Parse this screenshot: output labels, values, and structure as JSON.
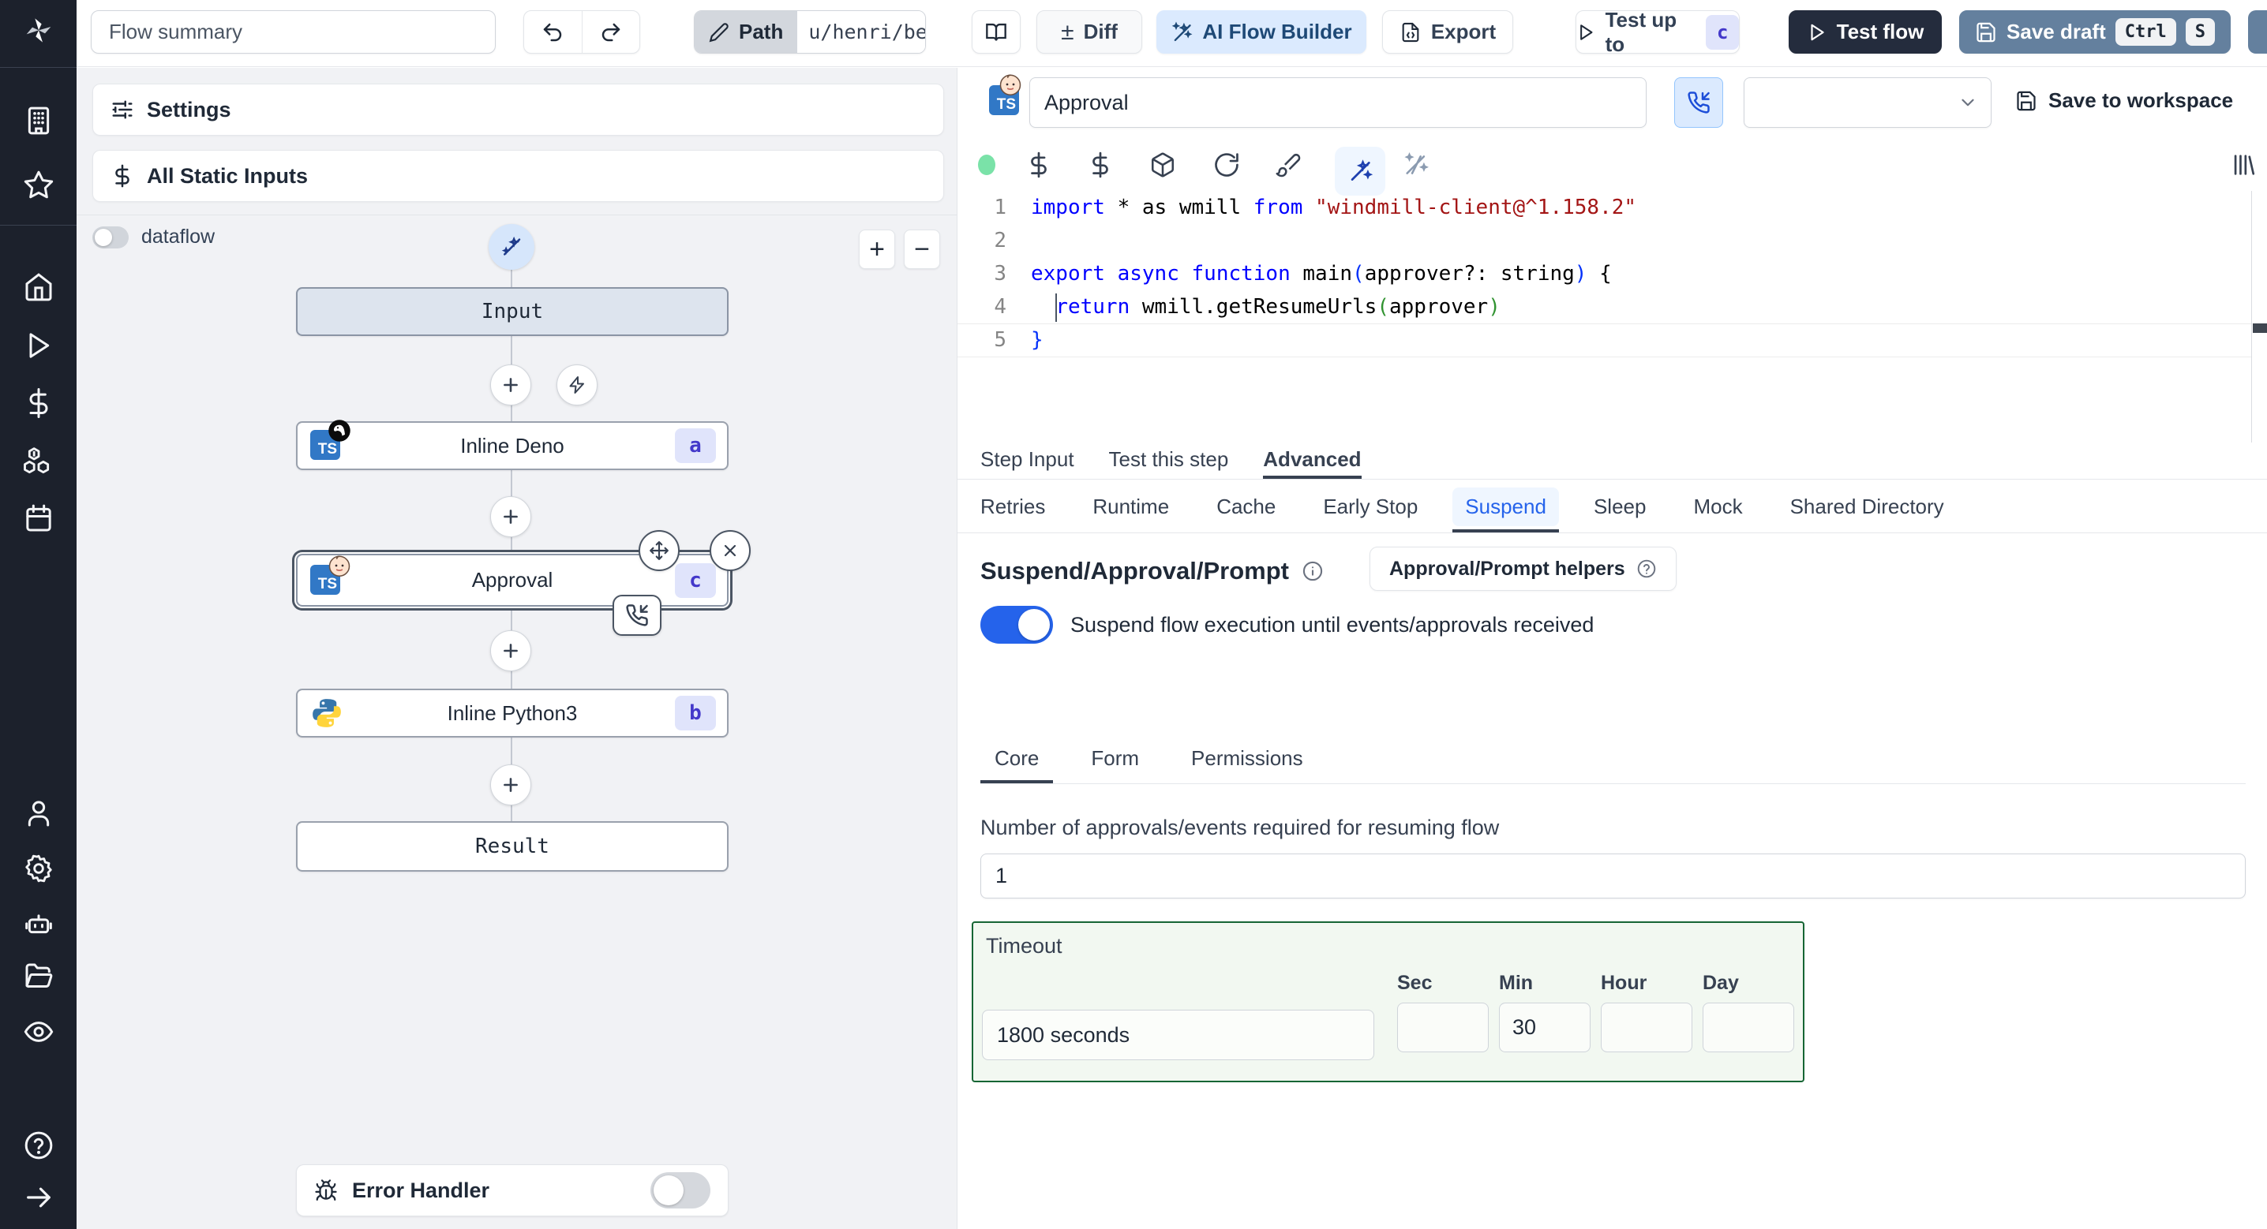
{
  "topbar": {
    "flow_summary_value": "Flow summary",
    "path_label": "Path",
    "path_value": "u/henri/bes",
    "diff_label": "Diff",
    "ai_flow_builder_label": "AI Flow Builder",
    "export_label": "Export",
    "test_up_to_label": "Test up to",
    "test_up_to_badge": "c",
    "test_flow_label": "Test flow",
    "save_draft_label": "Save draft",
    "save_draft_kbd_1": "Ctrl",
    "save_draft_kbd_2": "S"
  },
  "left_panel": {
    "settings_label": "Settings",
    "all_static_inputs_label": "All Static Inputs",
    "dataflow_label": "dataflow",
    "zoom_in_label": "+",
    "zoom_out_label": "−",
    "graph": {
      "input_label": "Input",
      "steps": [
        {
          "id": "a",
          "label": "Inline Deno"
        },
        {
          "id": "c",
          "label": "Approval"
        },
        {
          "id": "b",
          "label": "Inline Python3"
        }
      ],
      "result_label": "Result",
      "error_handler_label": "Error Handler"
    }
  },
  "step_editor": {
    "name_value": "Approval",
    "save_to_workspace_label": "Save to workspace",
    "code": {
      "lines": [
        {
          "num": "1",
          "tokens": [
            [
              "kw",
              "import"
            ],
            [
              "pl",
              " * as wmill "
            ],
            [
              "kw",
              "from"
            ],
            [
              "pl",
              " "
            ],
            [
              "str",
              "\"windmill-client@^1.158.2\""
            ]
          ]
        },
        {
          "num": "2",
          "tokens": []
        },
        {
          "num": "3",
          "tokens": [
            [
              "kw",
              "export"
            ],
            [
              "pl",
              " "
            ],
            [
              "kw",
              "async"
            ],
            [
              "pl",
              " "
            ],
            [
              "kw",
              "function"
            ],
            [
              "pl",
              " main"
            ],
            [
              "p1",
              "("
            ],
            [
              "pl",
              "approver?: string"
            ],
            [
              "p1",
              ")"
            ],
            [
              "pl",
              " {"
            ]
          ]
        },
        {
          "num": "4",
          "tokens": [
            [
              "pl",
              "  "
            ],
            [
              "kw",
              "return"
            ],
            [
              "pl",
              " wmill.getResumeUrls"
            ],
            [
              "p2",
              "("
            ],
            [
              "pl",
              "approver"
            ],
            [
              "p2",
              ")"
            ]
          ]
        },
        {
          "num": "5",
          "tokens": [
            [
              "p1",
              "}"
            ]
          ]
        }
      ]
    },
    "tabs": {
      "items": [
        "Step Input",
        "Test this step",
        "Advanced"
      ],
      "active": 2
    },
    "advanced_tabs": {
      "items": [
        "Retries",
        "Runtime",
        "Cache",
        "Early Stop",
        "Suspend",
        "Sleep",
        "Mock",
        "Shared Directory"
      ],
      "active": 4
    },
    "suspend": {
      "title": "Suspend/Approval/Prompt",
      "helpers_label": "Approval/Prompt helpers",
      "toggle_label": "Suspend flow execution until events/approvals received",
      "tabs": {
        "items": [
          "Core",
          "Form",
          "Permissions"
        ],
        "active": 0
      },
      "approvals_label": "Number of approvals/events required for resuming flow",
      "approvals_value": "1",
      "timeout": {
        "label": "Timeout",
        "value": "1800 seconds",
        "units": [
          {
            "label": "Sec",
            "value": ""
          },
          {
            "label": "Min",
            "value": "30"
          },
          {
            "label": "Hour",
            "value": ""
          },
          {
            "label": "Day",
            "value": ""
          }
        ]
      }
    }
  },
  "colors": {
    "accent_blue": "#2563eb",
    "ai_button_bg": "#dbeafe",
    "save_draft_bg": "#64809e",
    "test_flow_bg": "#242c3d",
    "timeout_border_green": "#166534",
    "timeout_bg_green": "#f2f8f1"
  }
}
